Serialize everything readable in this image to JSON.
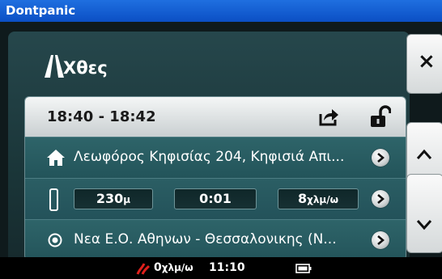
{
  "window": {
    "title": "Dontpanic"
  },
  "panel": {
    "title": "Χθες",
    "icon": "road-icon"
  },
  "trip": {
    "time_range": "18:40 - 18:42",
    "share_icon": "share-icon",
    "lock_icon": "unlock-icon",
    "origin": {
      "icon": "home-icon",
      "label": "Λεωφόρος Κηφισίας 204, Κηφισιά Απι..."
    },
    "stats": {
      "distance_value": "230",
      "distance_unit": "μ",
      "duration": "0:01",
      "speed_value": "8",
      "speed_unit": "χλμ/ω"
    },
    "destination": {
      "icon": "target-icon",
      "label": "Νεα Ε.Ο. Αθηνων - Θεσσαλονικης (Ν..."
    }
  },
  "side_buttons": {
    "close": "×",
    "up": "up-chevron-icon",
    "down": "down-chevron-icon"
  },
  "status": {
    "speed_value": "0",
    "speed_unit": "χλμ/ω",
    "clock": "11:10",
    "battery_icon": "battery-icon"
  },
  "colors": {
    "titlebar": "#0b4fc4",
    "accent_red": "#e0201c",
    "panel": "#1a3538"
  }
}
